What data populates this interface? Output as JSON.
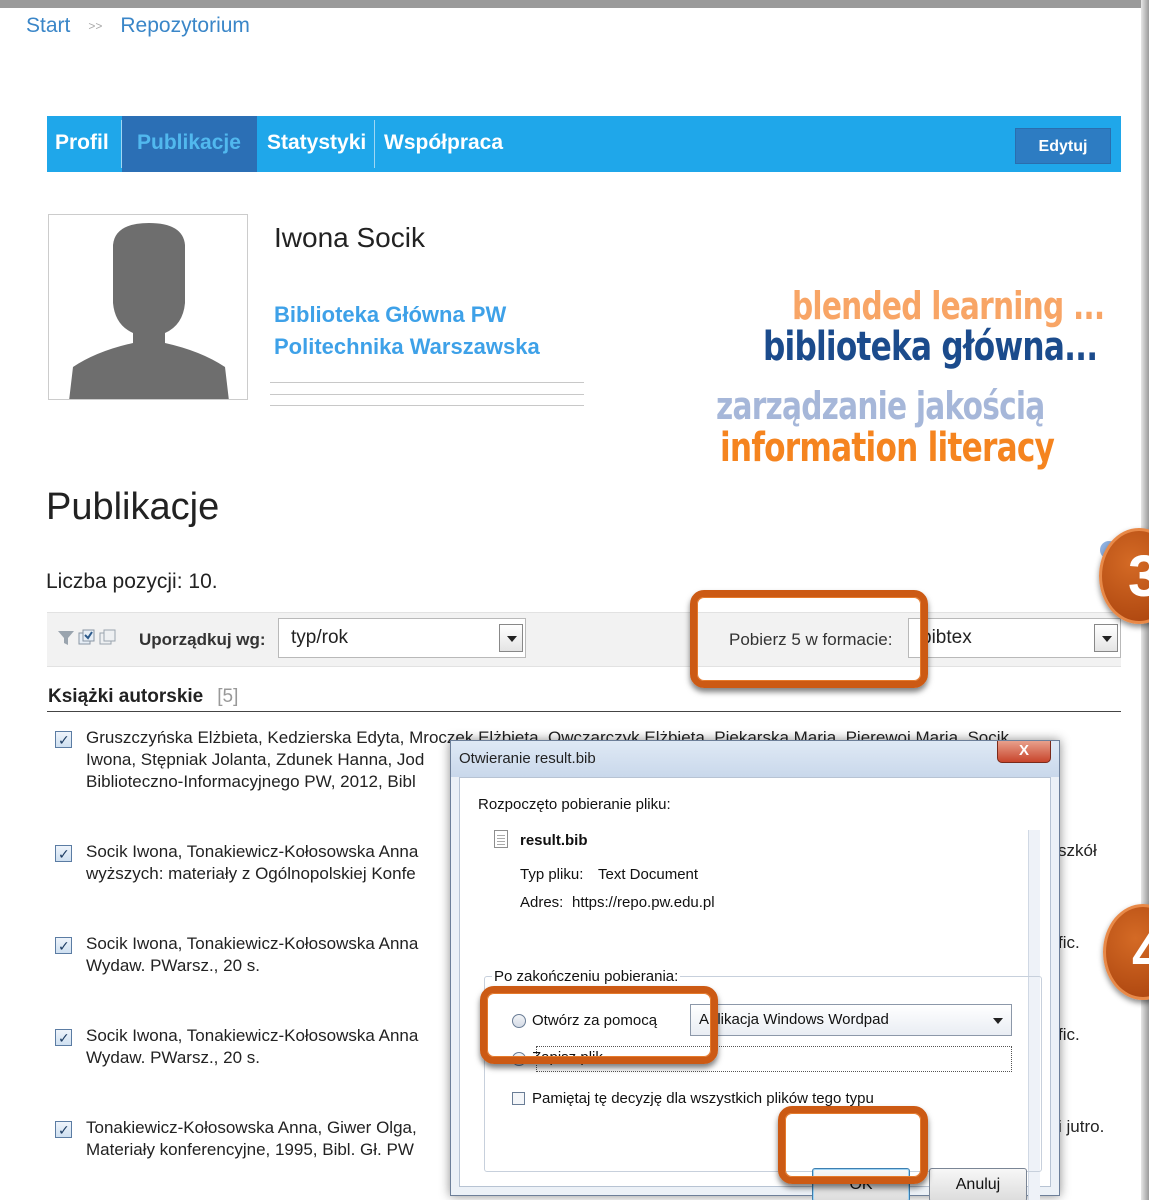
{
  "breadcrumb": {
    "start": "Start",
    "separator": ">>",
    "current": "Repozytorium"
  },
  "nav": {
    "tabs": [
      "Profil",
      "Publikacje",
      "Statystyki",
      "Współpraca"
    ],
    "active_tab": "Publikacje",
    "edit_button": "Edytuj",
    "colors": {
      "bar": "#1fa7ea",
      "active": "#2b6fb5"
    }
  },
  "profile": {
    "name": "Iwona Socik",
    "affiliation_1": "Biblioteka Główna PW",
    "affiliation_2": "Politechnika Warszawska"
  },
  "keywords": [
    {
      "text": "blended learning ...",
      "color": "#f8a566"
    },
    {
      "text": "biblioteka główna...",
      "color": "#1b4b8c"
    },
    {
      "text": "zarządzanie jakością",
      "color": "#a6b7d9"
    },
    {
      "text": "information literacy",
      "color": "#f5841f"
    }
  ],
  "publications": {
    "title": "Publikacje",
    "count_label": "Liczba pozycji: 10.",
    "sort_label": "Uporządkuj wg:",
    "sort_value": "typ/rok",
    "download_label": "Pobierz 5 w formacie:",
    "download_format": "bibtex",
    "toolbar_icons": [
      "filter-icon",
      "select-all-icon",
      "copy-icon"
    ],
    "category": {
      "title": "Książki autorskie",
      "count": "[5]"
    },
    "items": [
      {
        "line1": "Gruszczyńska Elżbieta, Kedzierska Edyta, Mroczek Elżbieta, Owczarczyk Elżbieta, Piekarska Maria, Pierewoi Maria, Socik",
        "line2": "Iwona, Stępniak Jolanta, Zdunek Hanna, Jod",
        "line3": "Biblioteczno-Informacyjnego PW, 2012, Bibl",
        "tail": ""
      },
      {
        "line1": "Socik Iwona, Tonakiewicz-Kołosowska Anna",
        "line2": "wyższych: materiały z Ogólnopolskiej Konfe",
        "tail": "szkół"
      },
      {
        "line1": "Socik Iwona, Tonakiewicz-Kołosowska Anna",
        "line2": "Wydaw. PWarsz., 20 s.",
        "tail": "fic."
      },
      {
        "line1": "Socik Iwona, Tonakiewicz-Kołosowska Anna",
        "line2": "Wydaw. PWarsz., 20 s.",
        "tail": "fic."
      },
      {
        "line1": "Tonakiewicz-Kołosowska Anna, Giwer Olga,",
        "line2": "Materiały konferencyjne, 1995, Bibl. Gł. PW",
        "tail": "i jutro."
      }
    ]
  },
  "steps": [
    "3",
    "4"
  ],
  "dialog": {
    "title": "Otwieranie result.bib",
    "close": "X",
    "started": "Rozpoczęto pobieranie pliku:",
    "filename": "result.bib",
    "type_label": "Typ pliku:",
    "type_value": "Text Document",
    "address_label": "Adres:",
    "address_value": "https://repo.pw.edu.pl",
    "after_label": "Po zakończeniu pobierania:",
    "open_with": "Otwórz za pomocą",
    "open_with_app": "Aplikacja Windows Wordpad",
    "save_file": "Zapisz plik",
    "remember": "Pamiętaj tę decyzję dla wszystkich plików tego typu",
    "ok": "OK",
    "cancel": "Anuluj"
  }
}
